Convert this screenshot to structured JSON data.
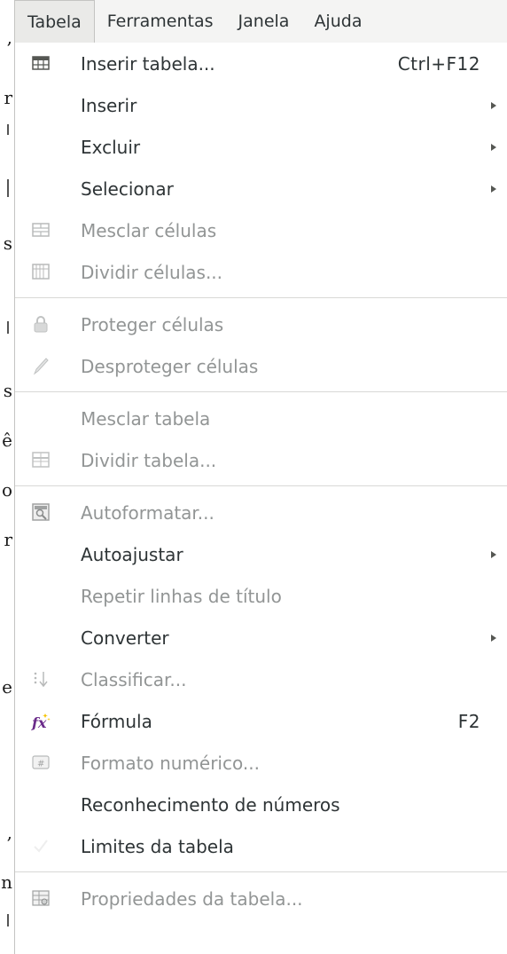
{
  "menubar": {
    "items": [
      {
        "label": "Tabela",
        "active": true
      },
      {
        "label": "Ferramentas",
        "active": false
      },
      {
        "label": "Janela",
        "active": false
      },
      {
        "label": "Ajuda",
        "active": false
      }
    ]
  },
  "menu": {
    "items": [
      {
        "label": "Inserir tabela...",
        "shortcut": "Ctrl+F12",
        "icon": "insert-table-icon",
        "enabled": true,
        "submenu": false
      },
      {
        "label": "Inserir",
        "shortcut": "",
        "icon": "",
        "enabled": true,
        "submenu": true
      },
      {
        "label": "Excluir",
        "shortcut": "",
        "icon": "",
        "enabled": true,
        "submenu": true
      },
      {
        "label": "Selecionar",
        "shortcut": "",
        "icon": "",
        "enabled": true,
        "submenu": true
      },
      {
        "label": "Mesclar células",
        "shortcut": "",
        "icon": "merge-cells-icon",
        "enabled": false,
        "submenu": false
      },
      {
        "label": "Dividir células...",
        "shortcut": "",
        "icon": "split-cells-icon",
        "enabled": false,
        "submenu": false
      },
      {
        "label": "Proteger células",
        "shortcut": "",
        "icon": "lock-icon",
        "enabled": false,
        "submenu": false
      },
      {
        "label": "Desproteger células",
        "shortcut": "",
        "icon": "pencil-icon",
        "enabled": false,
        "submenu": false
      },
      {
        "label": "Mesclar tabela",
        "shortcut": "",
        "icon": "",
        "enabled": false,
        "submenu": false
      },
      {
        "label": "Dividir tabela...",
        "shortcut": "",
        "icon": "split-table-icon",
        "enabled": false,
        "submenu": false
      },
      {
        "label": "Autoformatar...",
        "shortcut": "",
        "icon": "autoformat-icon",
        "enabled": false,
        "submenu": false
      },
      {
        "label": "Autoajustar",
        "shortcut": "",
        "icon": "",
        "enabled": true,
        "submenu": true
      },
      {
        "label": "Repetir linhas de título",
        "shortcut": "",
        "icon": "",
        "enabled": false,
        "submenu": false
      },
      {
        "label": "Converter",
        "shortcut": "",
        "icon": "",
        "enabled": true,
        "submenu": true
      },
      {
        "label": "Classificar...",
        "shortcut": "",
        "icon": "sort-icon",
        "enabled": false,
        "submenu": false
      },
      {
        "label": "Fórmula",
        "shortcut": "F2",
        "icon": "formula-icon",
        "enabled": true,
        "submenu": false
      },
      {
        "label": "Formato numérico...",
        "shortcut": "",
        "icon": "number-format-icon",
        "enabled": false,
        "submenu": false
      },
      {
        "label": "Reconhecimento de números",
        "shortcut": "",
        "icon": "",
        "enabled": true,
        "submenu": false
      },
      {
        "label": "Limites da tabela",
        "shortcut": "",
        "icon": "checkmark-icon",
        "enabled": true,
        "submenu": false
      },
      {
        "label": "Propriedades da tabela...",
        "shortcut": "",
        "icon": "table-properties-icon",
        "enabled": false,
        "submenu": false
      }
    ]
  },
  "background_doc": {
    "fragments": [
      ",",
      "r",
      "s",
      "s",
      "ê",
      "o",
      "r",
      "e",
      ",",
      "n"
    ]
  },
  "colors": {
    "menubar_bg": "#f4f4f3",
    "menu_bg": "#ffffff",
    "text_enabled": "#2e3436",
    "text_disabled": "#929595",
    "separator": "#d8d8d6"
  }
}
